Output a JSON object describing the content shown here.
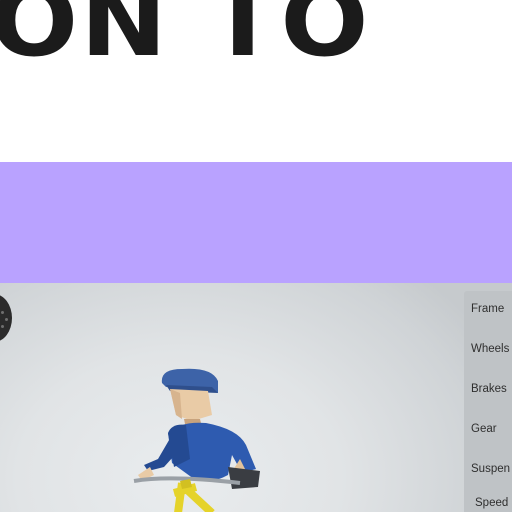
{
  "headline": {
    "text": "ON TO"
  },
  "colors": {
    "band": "#b9a2ff",
    "helmet": "#3d63a8",
    "jersey": "#2e5bb0",
    "frame": "#e5d32a",
    "skin": "#e9cba6"
  },
  "viewer": {
    "menu_icon": "circle-menu-icon",
    "panel": {
      "items": [
        {
          "label": "Frame"
        },
        {
          "label": "Wheels"
        },
        {
          "label": "Brakes"
        },
        {
          "label": "Gear"
        },
        {
          "label": "Suspen"
        },
        {
          "label": "Speed"
        }
      ]
    }
  }
}
